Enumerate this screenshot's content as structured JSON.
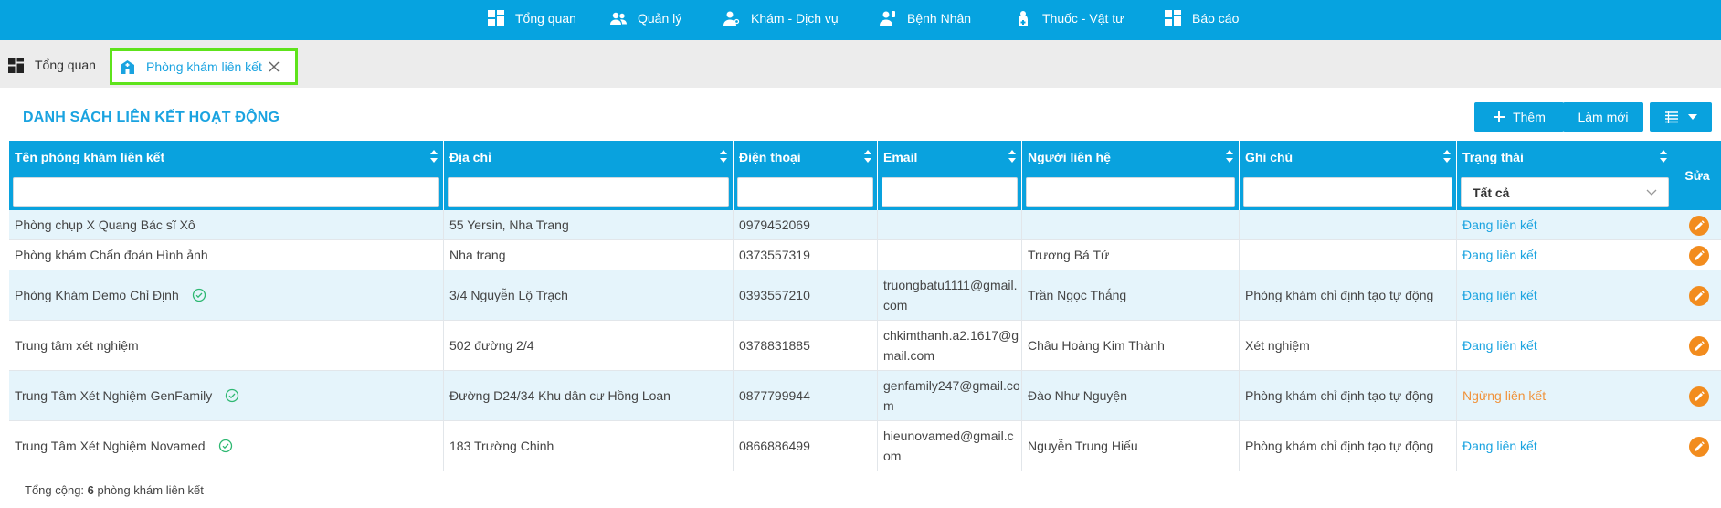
{
  "nav": {
    "items": [
      {
        "label": "Tổng quan",
        "icon": "dashboard-icon"
      },
      {
        "label": "Quản lý",
        "icon": "users-icon"
      },
      {
        "label": "Khám - Dịch vụ",
        "icon": "doctor-icon"
      },
      {
        "label": "Bệnh Nhân",
        "icon": "patient-icon"
      },
      {
        "label": "Thuốc - Vật tư",
        "icon": "medicine-icon"
      },
      {
        "label": "Báo cáo",
        "icon": "report-icon"
      }
    ]
  },
  "tabs": [
    {
      "label": "Tổng quan",
      "icon": "dashboard-icon"
    },
    {
      "label": "Phòng khám liên kết",
      "icon": "clinic-icon",
      "active": true
    }
  ],
  "page": {
    "title": "DANH SÁCH LIÊN KẾT HOẠT ĐỘNG",
    "buttons": {
      "add": "Thêm",
      "refresh": "Làm mới"
    }
  },
  "table": {
    "columns": [
      "Tên phòng khám liên kết",
      "Địa chỉ",
      "Điện thoại",
      "Email",
      "Người liên hệ",
      "Ghi chú",
      "Trạng thái"
    ],
    "edit_header": "Sửa",
    "status_filter_value": "Tất cả",
    "rows": [
      {
        "name": "Phòng chụp X Quang Bác sĩ Xô",
        "verified": false,
        "address": "55 Yersin, Nha Trang",
        "phone": "0979452069",
        "email": "",
        "contact": "",
        "note": "",
        "status": "Đang liên kết",
        "status_type": "active"
      },
      {
        "name": "Phòng khám Chẩn đoán Hình ảnh",
        "verified": false,
        "address": "Nha trang",
        "phone": "0373557319",
        "email": "",
        "contact": "Trương Bá Tứ",
        "note": "",
        "status": "Đang liên kết",
        "status_type": "active"
      },
      {
        "name": "Phòng Khám Demo Chỉ Định",
        "verified": true,
        "address": "3/4 Nguyễn Lộ Trạch",
        "phone": "0393557210",
        "email": "truongbatu1111@gmail.com",
        "contact": "Trần Ngọc Thắng",
        "note": "Phòng khám chỉ định tạo tự động",
        "status": "Đang liên kết",
        "status_type": "active"
      },
      {
        "name": "Trung tâm xét nghiệm",
        "verified": false,
        "address": "502 đường 2/4",
        "phone": "0378831885",
        "email": "chkimthanh.a2.1617@gmail.com",
        "contact": "Châu Hoàng Kim Thành",
        "note": "Xét nghiệm",
        "status": "Đang liên kết",
        "status_type": "active"
      },
      {
        "name": "Trung Tâm Xét Nghiệm GenFamily",
        "verified": true,
        "address": "Đường D24/34 Khu dân cư Hồng Loan",
        "phone": "0877799944",
        "email": "genfamily247@gmail.com",
        "contact": "Đào Như Nguyện",
        "note": "Phòng khám chỉ định tạo tự động",
        "status": "Ngừng liên kết",
        "status_type": "inactive"
      },
      {
        "name": "Trung Tâm Xét Nghiệm Novamed",
        "verified": true,
        "address": "183 Trường Chinh",
        "phone": "0866886499",
        "email": "hieunovamed@gmail.com",
        "contact": "Nguyễn Trung Hiếu",
        "note": "Phòng khám chỉ định tạo tự động",
        "status": "Đang liên kết",
        "status_type": "active"
      }
    ]
  },
  "footer": {
    "prefix": "Tổng cộng:",
    "count": "6",
    "suffix": "phòng khám liên kết"
  },
  "colors": {
    "primary": "#09a2de",
    "active_status": "#1aa3e0",
    "inactive_status": "#f0923a",
    "edit_button": "#f28c1e",
    "active_tab_border": "#5ee31b"
  }
}
